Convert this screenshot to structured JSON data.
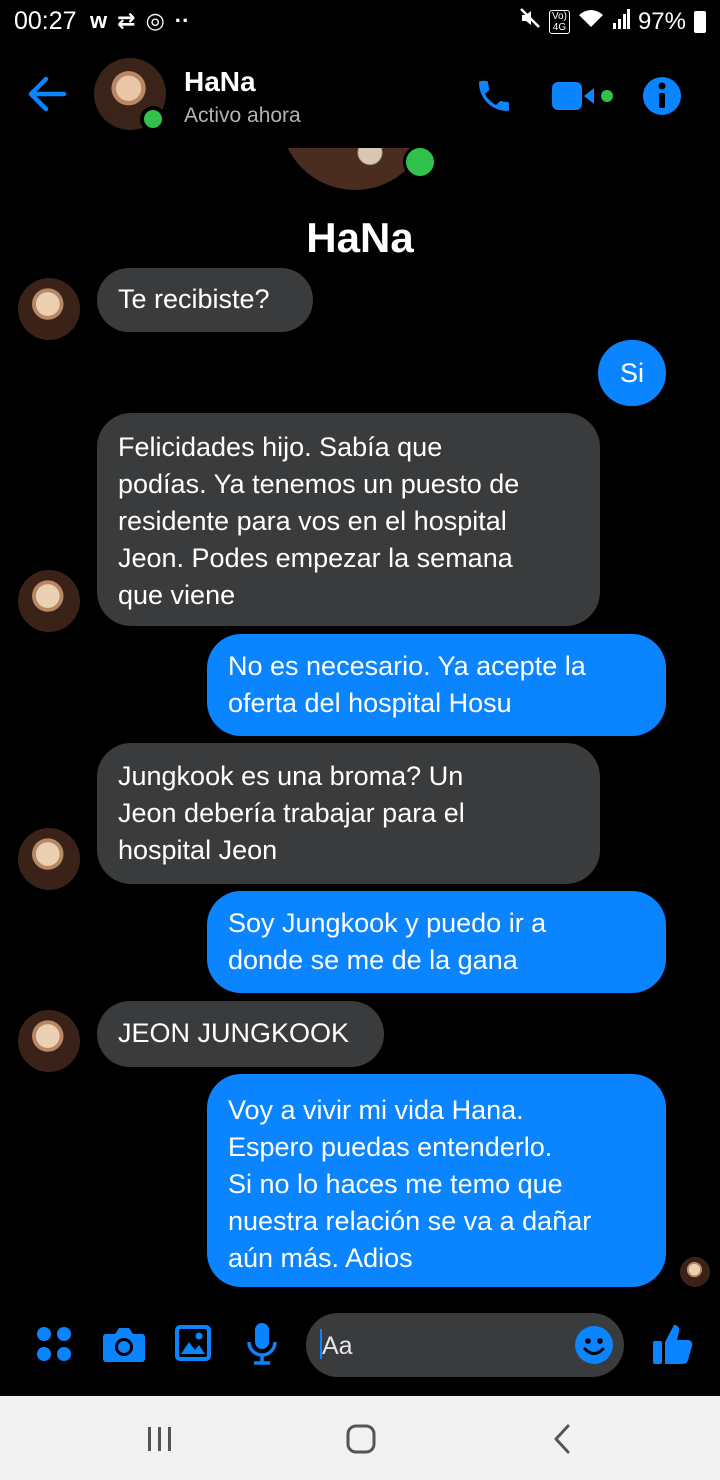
{
  "status_bar": {
    "time": "00:27",
    "left_icons": [
      "w-icon",
      "retweet-icon",
      "instagram-icon",
      "more-dots"
    ],
    "battery": "97%",
    "volte": "Vo)\n4G"
  },
  "header": {
    "contact_name": "HaNa",
    "contact_status": "Activo ahora"
  },
  "profile": {
    "name": "HaNa"
  },
  "messages": [
    {
      "from": "them",
      "text": "Te recibiste?"
    },
    {
      "from": "me",
      "text": "Si"
    },
    {
      "from": "them",
      "lines": [
        "Felicidades hijo. Sabía que",
        "podías. Ya tenemos un puesto de",
        "residente para vos en el hospital",
        "Jeon. Podes empezar la semana",
        "que viene"
      ]
    },
    {
      "from": "me",
      "lines": [
        "No es necesario. Ya acepte la",
        "oferta del hospital Hosu"
      ]
    },
    {
      "from": "them",
      "lines": [
        "Jungkook es una broma? Un",
        "Jeon debería trabajar para el",
        "hospital Jeon"
      ]
    },
    {
      "from": "me",
      "lines": [
        "Soy Jungkook y puedo ir a",
        "donde se me de la gana"
      ]
    },
    {
      "from": "them",
      "text": "JEON JUNGKOOK"
    },
    {
      "from": "me",
      "lines": [
        "Voy a vivir mi vida Hana.",
        "Espero puedas entenderlo.",
        "Si no lo haces me temo que",
        "nuestra relación se va a dañar",
        "aún más. Adios"
      ]
    }
  ],
  "composer": {
    "placeholder": "Aa"
  },
  "colors": {
    "accent": "#0a84ff",
    "incoming_bubble": "#3a3b3c",
    "online": "#31c24d",
    "background": "#000000"
  }
}
